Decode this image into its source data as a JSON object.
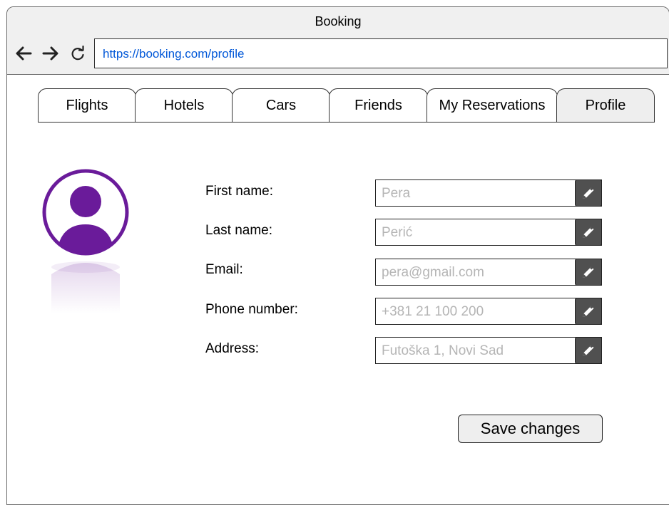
{
  "window": {
    "title": "Booking"
  },
  "browser": {
    "url": "https://booking.com/profile",
    "back_icon": "arrow-left-icon",
    "forward_icon": "arrow-right-icon",
    "reload_icon": "reload-icon"
  },
  "tabs": [
    {
      "label": "Flights",
      "active": false
    },
    {
      "label": "Hotels",
      "active": false
    },
    {
      "label": "Cars",
      "active": false
    },
    {
      "label": "Friends",
      "active": false
    },
    {
      "label": "My Reservations",
      "active": false
    },
    {
      "label": "Profile",
      "active": true
    }
  ],
  "profile": {
    "avatar_icon": "user-avatar-icon",
    "avatar_color": "#6a1b9a",
    "fields": [
      {
        "label": "First name:",
        "value": "Pera"
      },
      {
        "label": "Last name:",
        "value": "Perić"
      },
      {
        "label": "Email:",
        "value": "pera@gmail.com"
      },
      {
        "label": "Phone number:",
        "value": "+381 21 100 200"
      },
      {
        "label": "Address:",
        "value": "Futoška 1, Novi Sad"
      }
    ],
    "edit_icon": "pencil-icon"
  },
  "actions": {
    "save_label": "Save changes"
  }
}
